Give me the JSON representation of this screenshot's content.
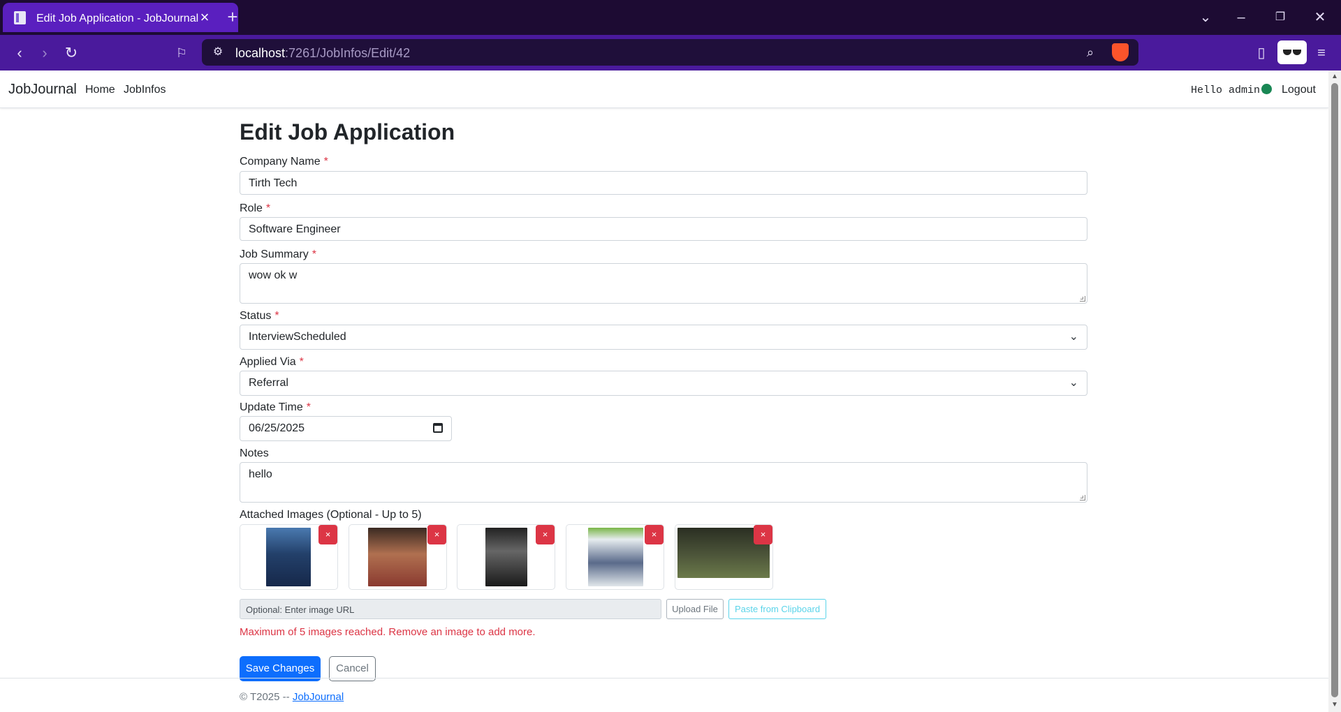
{
  "browser": {
    "tab_title": "Edit Job Application - JobJournal",
    "url_host": "localhost",
    "url_path": ":7261/JobInfos/Edit/42",
    "accent": "#4a1a9c"
  },
  "navbar": {
    "brand": "JobJournal",
    "links": [
      "Home",
      "JobInfos"
    ],
    "greeting": "Hello admin!",
    "logout": "Logout"
  },
  "form": {
    "title": "Edit Job Application",
    "required_mark": "*",
    "company": {
      "label": "Company Name",
      "value": "Tirth Tech"
    },
    "role": {
      "label": "Role",
      "value": "Software Engineer"
    },
    "summary": {
      "label": "Job Summary",
      "value": "wow ok w"
    },
    "status": {
      "label": "Status",
      "value": "InterviewScheduled"
    },
    "applied_via": {
      "label": "Applied Via",
      "value": "Referral"
    },
    "update_time": {
      "label": "Update Time",
      "value": "06/25/2025"
    },
    "notes": {
      "label": "Notes",
      "value": "hello"
    },
    "images": {
      "label": "Attached Images (Optional - Up to 5)",
      "remove_label": "×",
      "url_placeholder": "Optional: Enter image URL",
      "upload_label": "Upload File",
      "paste_label": "Paste from Clipboard",
      "limit_message": "Maximum of 5 images reached. Remove an image to add more."
    },
    "save_label": "Save Changes",
    "cancel_label": "Cancel"
  },
  "footer": {
    "text": "© T2025 -- ",
    "link": "JobJournal"
  }
}
